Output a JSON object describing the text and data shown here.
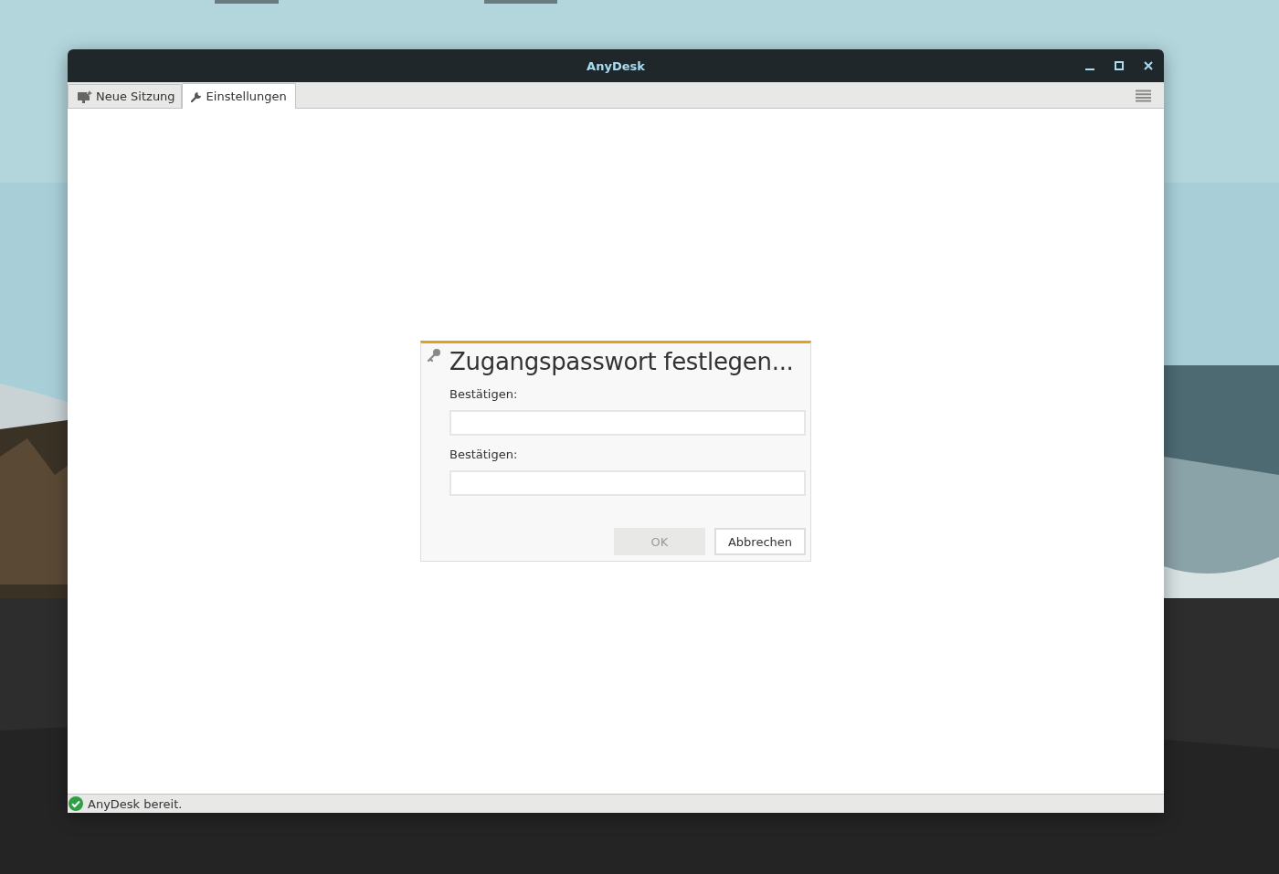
{
  "window": {
    "title": "AnyDesk"
  },
  "tabs": [
    {
      "label": "Neue Sitzung",
      "selected": false,
      "kind": "session"
    },
    {
      "label": "Einstellungen",
      "selected": true,
      "kind": "settings"
    }
  ],
  "dialog": {
    "title": "Zugangspasswort festlegen...",
    "fields": [
      {
        "label": "Bestätigen:"
      },
      {
        "label": "Bestätigen:"
      }
    ],
    "buttons": [
      {
        "label": "OK",
        "disabled": true
      },
      {
        "label": "Abbrechen",
        "disabled": false
      }
    ]
  },
  "status_bar": {
    "text": "AnyDesk bereit."
  }
}
